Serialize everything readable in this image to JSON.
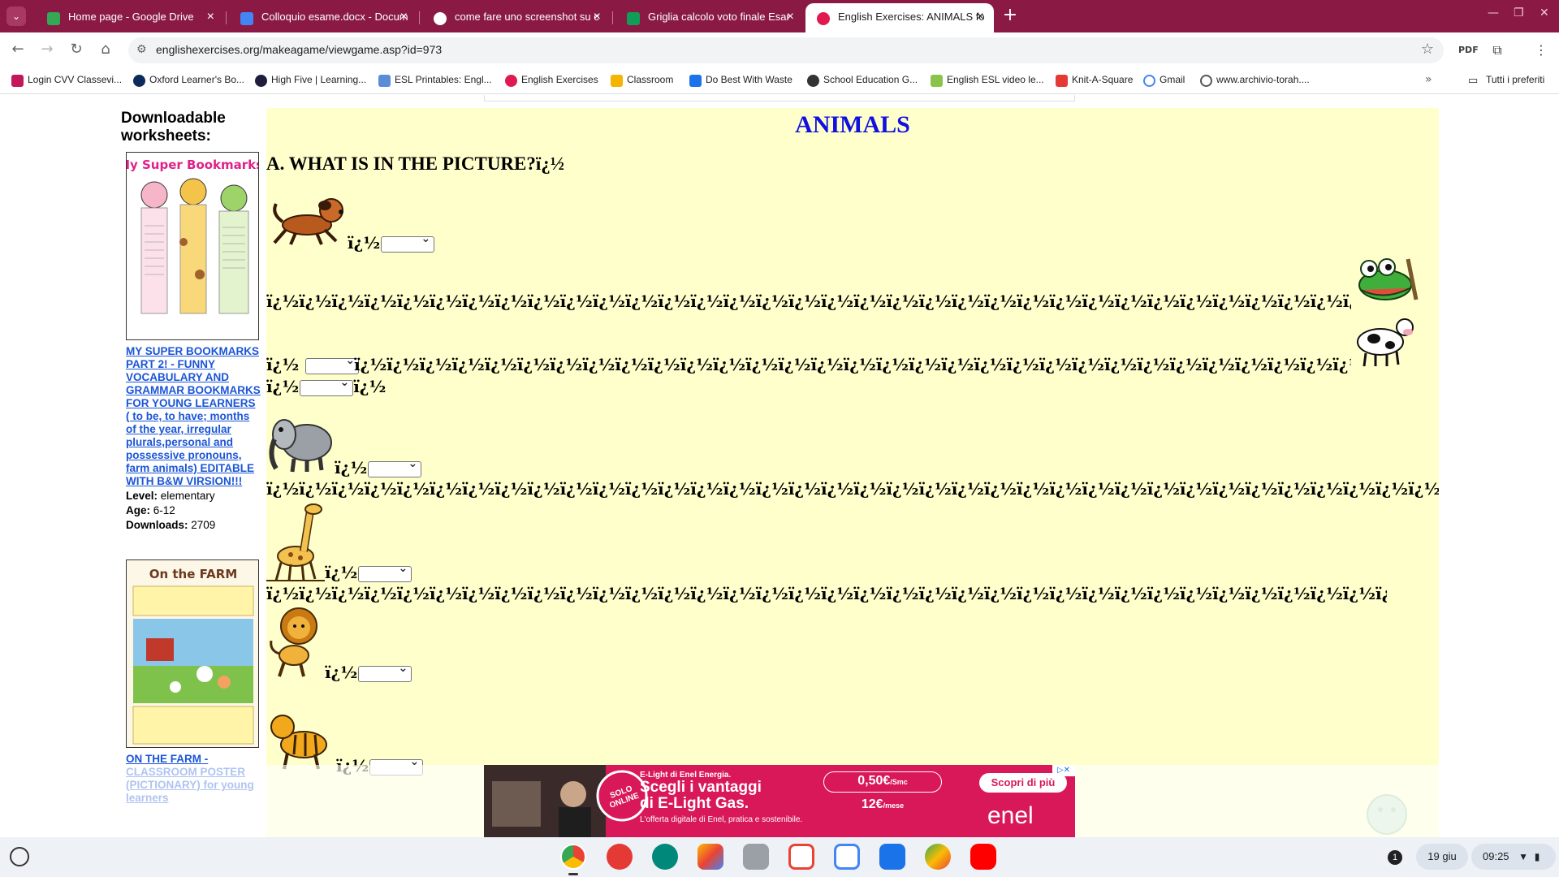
{
  "browser": {
    "tabs": [
      {
        "title": "Home page - Google Drive",
        "color": "#34a853"
      },
      {
        "title": "Colloquio esame.docx - Docum",
        "color": "#4285f4"
      },
      {
        "title": "come fare uno screenshot su c",
        "color": "#ffffff"
      },
      {
        "title": "Griglia calcolo voto finale Esar",
        "color": "#0f9d58"
      },
      {
        "title": "English Exercises: ANIMALS fo",
        "color": "#e01a4f"
      }
    ],
    "active_tab": 4,
    "url": "englishexercises.org/makeagame/viewgame.asp?id=973",
    "bookmarks": [
      "Login CVV Classevi...",
      "Oxford Learner's Bo...",
      "High Five | Learning...",
      "ESL Printables: Engl...",
      "English Exercises",
      "Classroom",
      "Do Best With Waste",
      "School Education G...",
      "English ESL video le...",
      "Knit-A-Square",
      "Gmail",
      "www.archivio-torah...."
    ],
    "all_bookmarks": "Tutti i preferiti"
  },
  "sidebar": {
    "title": "Downloadable worksheets:",
    "worksheets": [
      {
        "link": "MY SUPER BOOKMARKS PART 2! - FUNNY VOCABULARY AND GRAMMAR BOOKMARKS FOR YOUNG LEARNERS ( to be, to have; months of the year, irregular plurals,personal and possessive pronouns, farm animals) EDITABLE WITH B&W VIRSION!!!",
        "level_label": "Level:",
        "level": "elementary",
        "age_label": "Age:",
        "age": "6-12",
        "downloads_label": "Downloads:",
        "downloads": "2709",
        "thumb_title": "My Super Bookmarks!"
      },
      {
        "link": "ON THE FARM - CLASSROOM POSTER (PICTIONARY) for young learners",
        "thumb_title": "On the FARM"
      }
    ]
  },
  "exercise": {
    "title": "ANIMALS",
    "section": "A. WHAT IS IN THE PICTURE?ï¿½",
    "glyph": "ï¿½",
    "garble_line": "ï¿½ï¿½ï¿½ï¿½ï¿½ï¿½ï¿½ï¿½ï¿½ï¿½ï¿½ï¿½ï¿½ï¿½ï¿½ï¿½ï¿½ï¿½ï¿½ï¿½ï¿½ï¿½ï¿½ï¿½ï¿½ï¿½ï¿½ï¿½ï¿½ï¿½ï¿½ï¿½ï¿½ï¿½ï¿½ï¿½ï¿½ï¿½ï¿½ï¿½ï¿½ï¿½ï¿½ï¿½ï¿½ï¿½ï¿½ï¿½ï¿½ï¿½ï¿½ï¿½ï¿½ï¿½ï¿½ï¿½ï¿½ï¿½ï¿½ï¿½ï¿½ï¿½ï¿½ï¿½ï¿½ï¿½ï¿½ï¿½ï¿½ï¿½"
  },
  "ad": {
    "brand_line": "E-Light di Enel Energia.",
    "headline_1": "Scegli i vantaggi",
    "headline_2": "di E-Light Gas.",
    "sub": "L'offerta digitale di Enel, pratica e sostenibile.",
    "price_1": "0,50€",
    "price_1_unit": "/Smc",
    "price_2": "12€",
    "price_2_unit": "/mese",
    "badge": "SOLO ONLINE",
    "cta": "Scopri di più",
    "logo": "enel"
  },
  "shelf": {
    "notification_count": "1",
    "date": "19 giu",
    "time": "09:25"
  }
}
